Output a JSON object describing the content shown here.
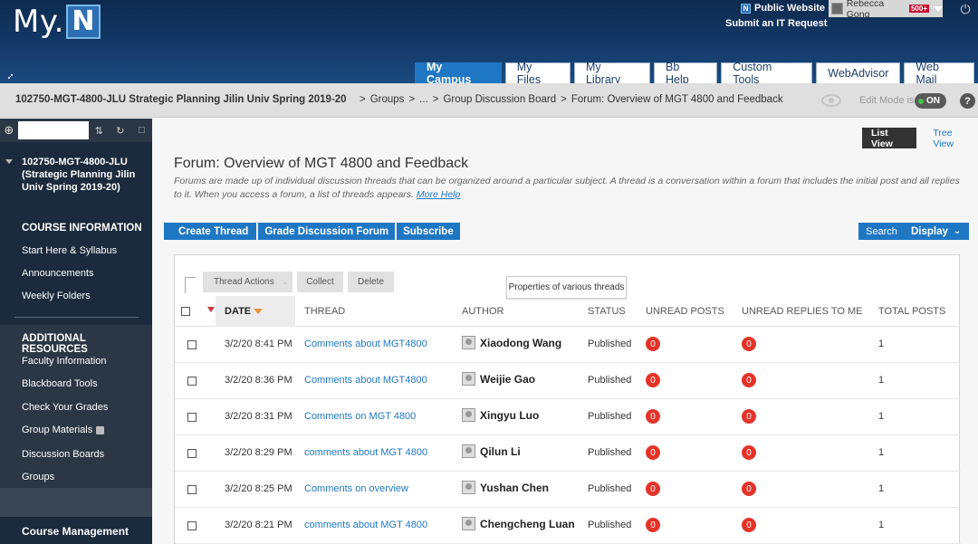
{
  "header": {
    "logo_text": "My.",
    "logo_letter": "N",
    "public_website": "Public Website",
    "public_website_icon": "N",
    "it_request": "Submit an IT Request",
    "user_name": "Rebecca Gong",
    "user_badge": "500+",
    "power_icon": "⏻",
    "link_icon": "↔"
  },
  "tabs": [
    {
      "label": "My Campus"
    },
    {
      "label": "My Files"
    },
    {
      "label": "My Library"
    },
    {
      "label": "Bb Help"
    },
    {
      "label": "Custom Tools"
    },
    {
      "label": "WebAdvisor"
    },
    {
      "label": "Web Mail"
    }
  ],
  "breadcrumb": {
    "course": "102750-MGT-4800-JLU Strategic Planning Jilin Univ Spring 2019-20",
    "caret": "⌄",
    "trail": [
      ">",
      "Groups",
      ">",
      "...",
      ">",
      "Group Discussion Board",
      ">",
      "Forum: Overview of MGT 4800 and Feedback"
    ],
    "edit_mode_label": "Edit Mode is:",
    "edit_mode_value": "ON",
    "help": "?"
  },
  "sidebar": {
    "plus": "⊕",
    "tool_icons": [
      "⇅",
      "↻",
      "□"
    ],
    "course_title": "102750-MGT-4800-JLU (Strategic Planning Jilin Univ Spring 2019-20)",
    "section1_title": "COURSE INFORMATION",
    "section1_items": [
      "Start Here & Syllabus",
      "Announcements",
      "Weekly Folders"
    ],
    "section2_title": "ADDITIONAL RESOURCES",
    "section2_items": [
      "Faculty Information",
      "Blackboard Tools",
      "Check Your Grades",
      "Group Materials",
      "Discussion Boards",
      "Groups"
    ],
    "management": "Course Management"
  },
  "main": {
    "list_view": "List View",
    "tree_view": "Tree View",
    "title": "Forum: Overview of MGT 4800 and Feedback",
    "description": "Forums are made up of individual discussion threads that can be organized around a particular subject. A thread is a conversation within a forum that includes the initial post and all replies to it. When you access a forum, a list of threads appears.",
    "more_help": "More Help",
    "actions": [
      "Create Thread",
      "Grade Discussion Forum",
      "Subscribe"
    ],
    "search": "Search",
    "display": "Display",
    "display_chevron": "⌄",
    "thread_actions": "Thread Actions",
    "thread_actions_chevron": "⌄",
    "collect": "Collect",
    "delete": "Delete",
    "tooltip": "Properties of various threads",
    "columns": {
      "date": "DATE",
      "thread": "THREAD",
      "author": "AUTHOR",
      "status": "STATUS",
      "unread": "UNREAD POSTS",
      "replies": "UNREAD REPLIES TO ME",
      "total": "TOTAL POSTS"
    },
    "rows": [
      {
        "date": "3/2/20 8:41 PM",
        "thread": "Comments about MGT4800",
        "author": "Xiaodong Wang",
        "status": "Published",
        "unread": "0",
        "replies": "0",
        "total": "1"
      },
      {
        "date": "3/2/20 8:36 PM",
        "thread": "Comments about MGT4800",
        "author": "Weijie Gao",
        "status": "Published",
        "unread": "0",
        "replies": "0",
        "total": "1"
      },
      {
        "date": "3/2/20 8:31 PM",
        "thread": "Comments on MGT 4800",
        "author": "Xingyu Luo",
        "status": "Published",
        "unread": "0",
        "replies": "0",
        "total": "1"
      },
      {
        "date": "3/2/20 8:29 PM",
        "thread": "comments about MGT 4800",
        "author": "Qilun Li",
        "status": "Published",
        "unread": "0",
        "replies": "0",
        "total": "1"
      },
      {
        "date": "3/2/20 8:25 PM",
        "thread": "Comments on overview",
        "author": "Yushan Chen",
        "status": "Published",
        "unread": "0",
        "replies": "0",
        "total": "1"
      },
      {
        "date": "3/2/20 8:21 PM",
        "thread": "comments about MGT 4800",
        "author": "Chengcheng Luan",
        "status": "Published",
        "unread": "0",
        "replies": "0",
        "total": "1"
      }
    ]
  }
}
